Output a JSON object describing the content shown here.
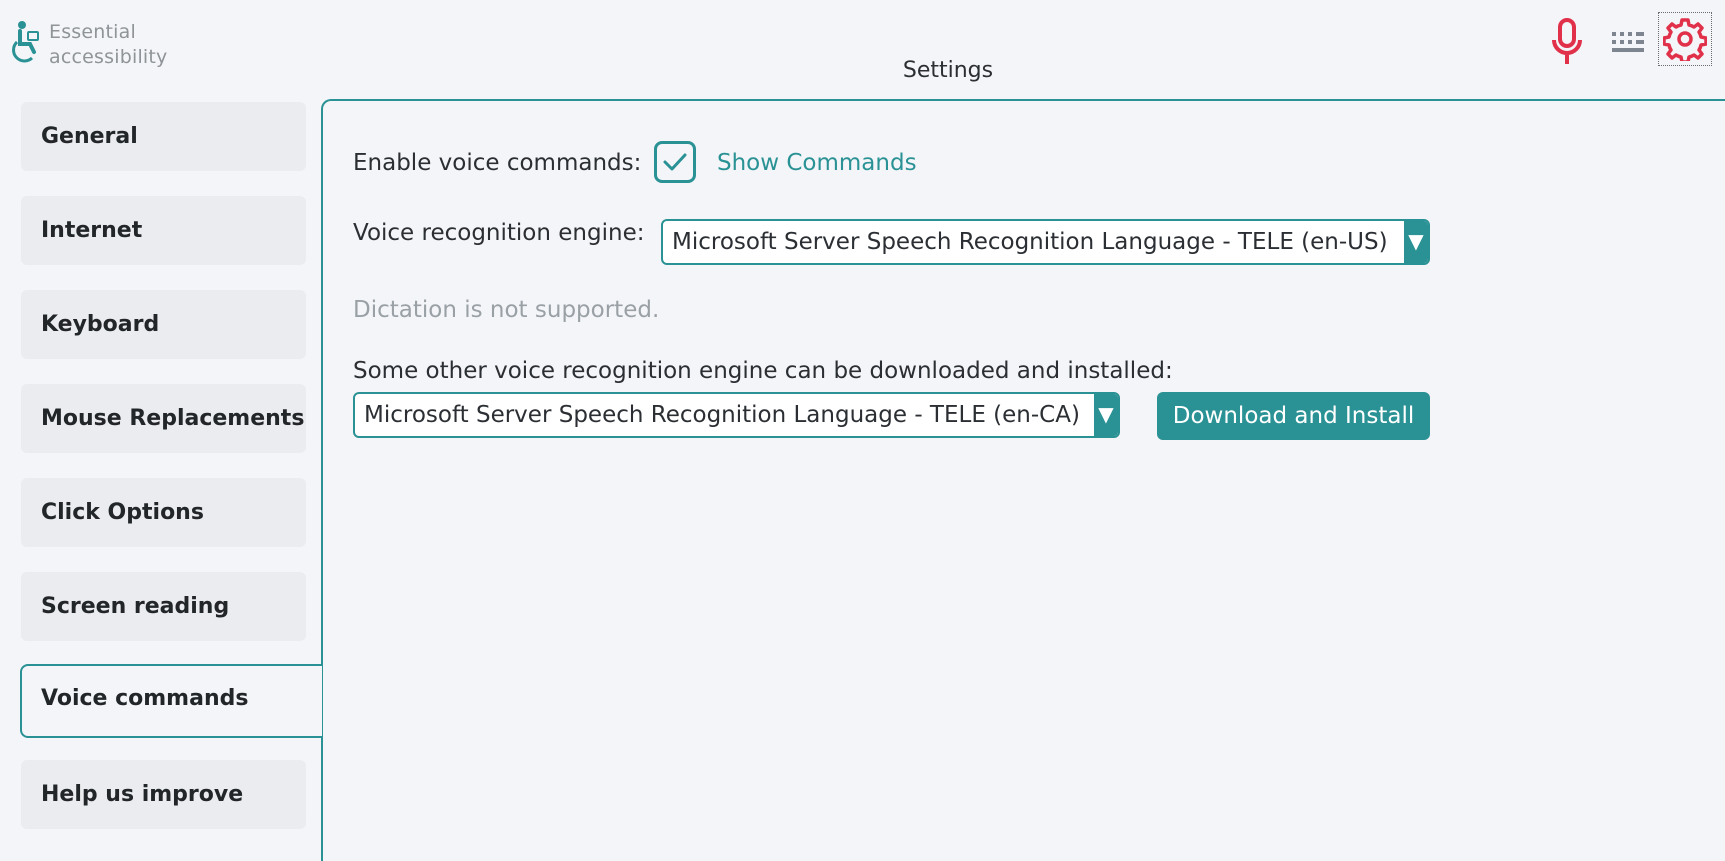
{
  "app": {
    "logo_line1": "Essential",
    "logo_line2": "accessibility",
    "page_title": "Settings"
  },
  "toolbar": {
    "icons": [
      "microphone-icon",
      "keyboard-icon",
      "gear-icon"
    ],
    "colors": {
      "accent": "#2a9295",
      "icon_red": "#e0304a",
      "icon_gray": "#7d8590"
    }
  },
  "sidebar": {
    "items": [
      {
        "label": "General"
      },
      {
        "label": "Internet"
      },
      {
        "label": "Keyboard"
      },
      {
        "label": "Mouse Replacements"
      },
      {
        "label": "Click Options"
      },
      {
        "label": "Screen reading"
      },
      {
        "label": "Voice commands",
        "active": true
      },
      {
        "label": "Help us improve"
      }
    ]
  },
  "panel": {
    "enable_voice_label": "Enable voice commands:",
    "enable_voice_checked": true,
    "show_commands_link": "Show Commands",
    "engine_label": "Voice recognition engine:",
    "engine_selected": "Microsoft Server Speech Recognition Language - TELE (en-US)",
    "dictation_note": "Dictation is not supported.",
    "other_engine_label": "Some other voice recognition engine can be downloaded and installed:",
    "other_engine_selected": "Microsoft Server Speech Recognition Language - TELE (en-CA)",
    "download_button": "Download and Install"
  }
}
